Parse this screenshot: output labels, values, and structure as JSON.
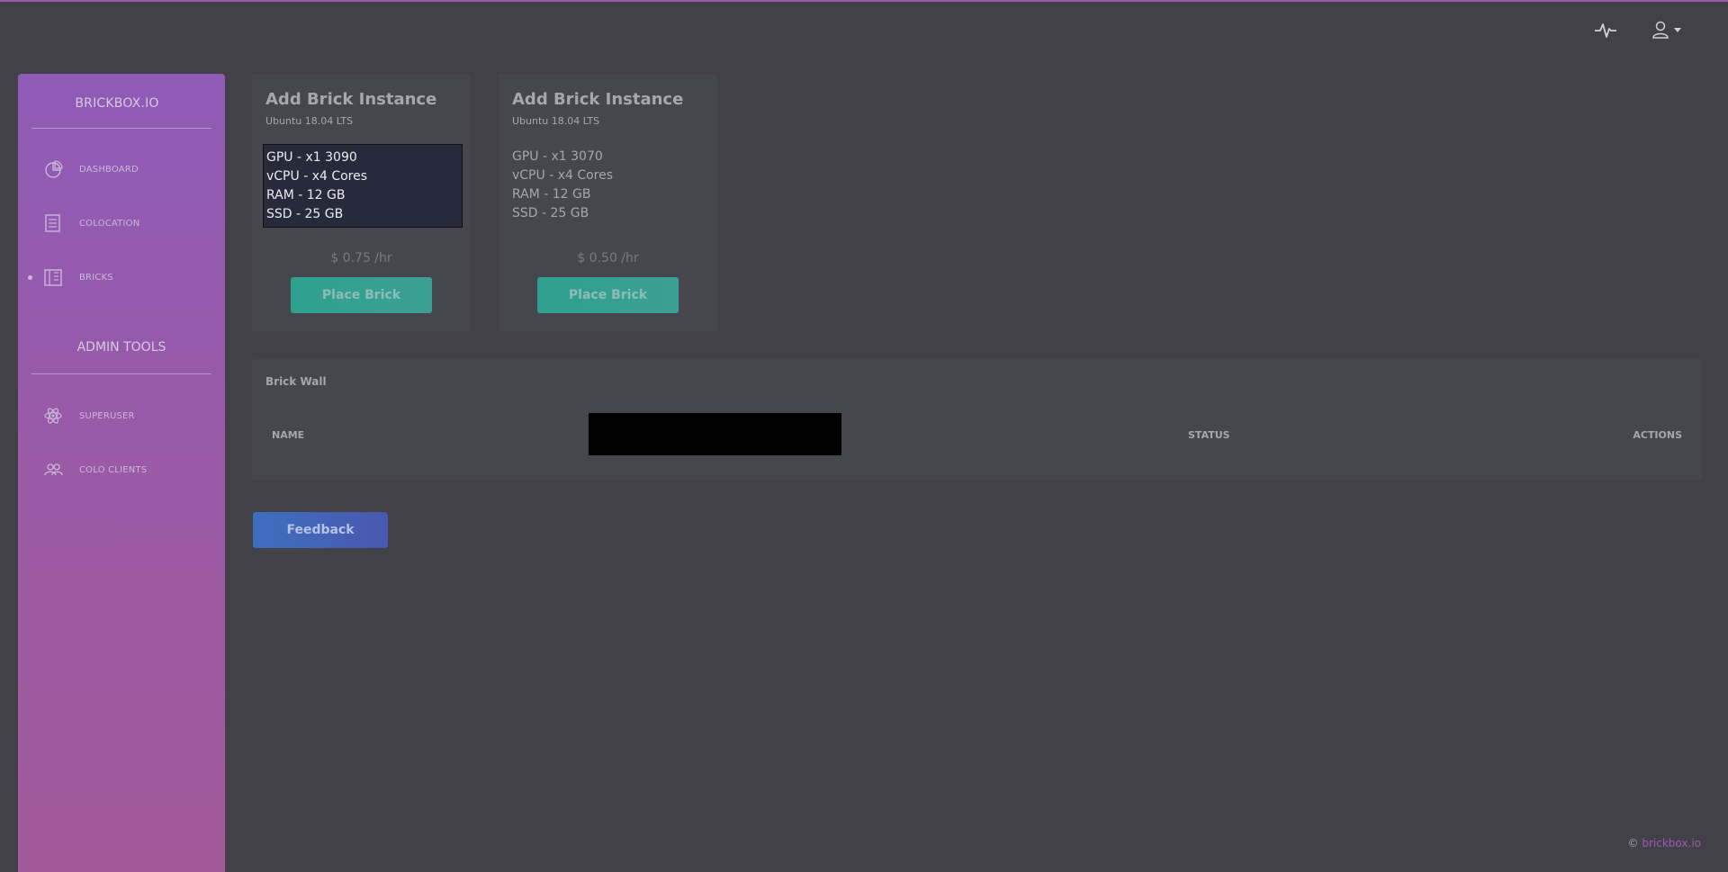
{
  "colors": {
    "sidebar_gradient_start": "#8f5bb7",
    "sidebar_gradient_end": "#a35a9a",
    "background": "#414147",
    "card": "#46464f",
    "place_button": "#2fa08f",
    "feedback_button": "#3d6fbe"
  },
  "topbar": {
    "icons": [
      "pulse-icon",
      "user-icon",
      "chevron-down-icon"
    ]
  },
  "sidebar": {
    "brand": "BRICKBOX.IO",
    "items": [
      {
        "label": "DASHBOARD",
        "icon": "pie-chart-icon",
        "active": false
      },
      {
        "label": "COLOCATION",
        "icon": "document-icon",
        "active": false
      },
      {
        "label": "BRICKS",
        "icon": "building-icon",
        "active": true
      }
    ],
    "admin_title": "ADMIN TOOLS",
    "admin_items": [
      {
        "label": "SUPERUSER",
        "icon": "atom-icon"
      },
      {
        "label": "COLO CLIENTS",
        "icon": "users-icon"
      }
    ]
  },
  "cards": [
    {
      "title": "Add Brick Instance",
      "subtitle": "Ubuntu 18.04 LTS",
      "specs": [
        "GPU - x1 3090",
        "vCPU - x4 Cores",
        "RAM - 12 GB",
        "SSD - 25 GB"
      ],
      "price": "$ 0.75 /hr",
      "button": "Place Brick",
      "selected": true
    },
    {
      "title": "Add Brick Instance",
      "subtitle": "Ubuntu 18.04 LTS",
      "specs": [
        "GPU - x1 3070",
        "vCPU - x4 Cores",
        "RAM - 12 GB",
        "SSD - 25 GB"
      ],
      "price": "$ 0.50 /hr",
      "button": "Place Brick",
      "selected": false
    }
  ],
  "brick_wall": {
    "title": "Brick Wall",
    "columns": [
      "NAME",
      "STATUS",
      "ACTIONS"
    ]
  },
  "feedback_button": "Feedback",
  "footer": {
    "copyright": "©",
    "link": "brickbox.io"
  }
}
